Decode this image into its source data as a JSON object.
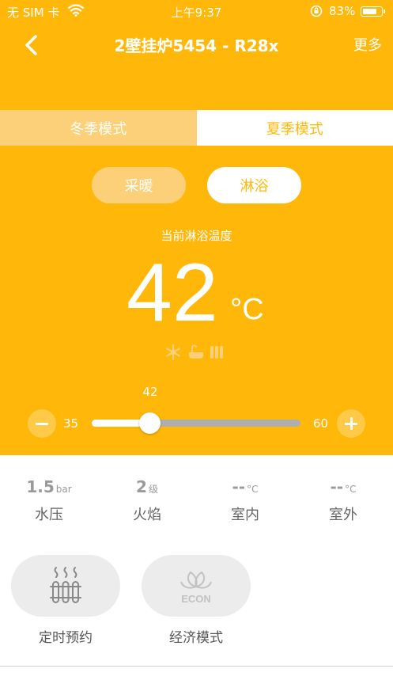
{
  "status_bar": {
    "carrier": "无 SIM 卡",
    "time": "上午9:37",
    "battery": "83%",
    "battery_level": 0.83
  },
  "nav": {
    "title": "2壁挂炉5454 - R28x",
    "more": "更多"
  },
  "season_tabs": [
    {
      "label": "冬季模式",
      "selected": false
    },
    {
      "label": "夏季模式",
      "selected": true
    }
  ],
  "mode_buttons": [
    {
      "label": "采暖",
      "selected": false
    },
    {
      "label": "淋浴",
      "selected": true
    }
  ],
  "temperature": {
    "label": "当前淋浴温度",
    "value": "42",
    "unit": "°C"
  },
  "slider": {
    "value": 42,
    "value_label": "42",
    "min": 35,
    "max": 60,
    "min_label": "35",
    "max_label": "60"
  },
  "stats": [
    {
      "value": "1.5",
      "unit": "bar",
      "label": "水压"
    },
    {
      "value": "2",
      "unit": "级",
      "label": "火焰"
    },
    {
      "value": "--",
      "unit": "°C",
      "label": "室内"
    },
    {
      "value": "--",
      "unit": "°C",
      "label": "室外"
    }
  ],
  "functions": [
    {
      "label": "定时预约",
      "icon": "radiator-timer-icon"
    },
    {
      "label": "经济模式",
      "icon": "econ-leaf-icon",
      "icon_text": "ECON"
    }
  ],
  "colors": {
    "primary": "#FFB80A",
    "light": "#FCD078",
    "track": "#AEAEAE",
    "func_bg": "#ECECEC"
  }
}
